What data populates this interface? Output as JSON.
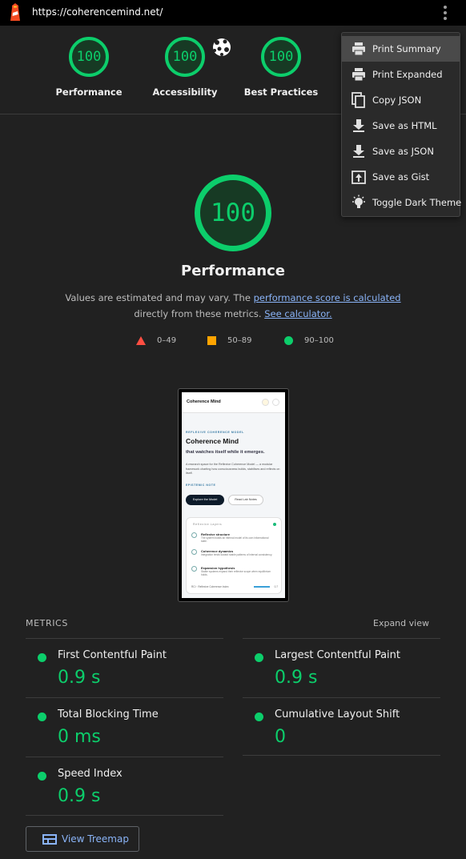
{
  "browser": {
    "url": "https://coherencemind.net/"
  },
  "summary_gauges": [
    {
      "label": "Performance",
      "score": "100"
    },
    {
      "label": "Accessibility",
      "score": "100"
    },
    {
      "label": "Best Practices",
      "score": "100"
    }
  ],
  "performance": {
    "score": "100",
    "title": "Performance",
    "desc_part1": "Values are estimated and may vary. The ",
    "desc_link1": "performance score is calculated",
    "desc_part2": "directly from these metrics. ",
    "desc_link2": "See calculator."
  },
  "legend": [
    {
      "label": "0–49",
      "color": "#ff4e42",
      "shape": "triangle"
    },
    {
      "label": "50–89",
      "color": "#ffa400",
      "shape": "square"
    },
    {
      "label": "90–100",
      "color": "#0cce6b",
      "shape": "circle"
    }
  ],
  "thumbnail": {
    "brand": "Coherence Mind",
    "eyebrow": "REFLEXIVE COHERENCE MODEL",
    "heading": "Coherence Mind",
    "subheading": "that watches itself while it emerges.",
    "paragraph": "A research space for the Reflexive Coherence Model — a modular framework charting how consciousness builds, stabilises and reflects on itself.",
    "note_label": "EPISTEMIC NOTE",
    "primary_button": "Explore the Model",
    "secondary_button": "Read Lab Notes",
    "card_title": "Reflexive Layers",
    "card_rows": [
      {
        "title": "Reflexive structure",
        "desc": "The system builds an internal model of its own informational state."
      },
      {
        "title": "Coherence dynamics",
        "desc": "Integration tends toward stable patterns of internal consistency."
      },
      {
        "title": "Expansion hypothesis",
        "desc": "Stable systems expand their reflexive scope when equilibrium holds."
      }
    ],
    "card_footer": "RCI · Reflexive Coherence Index",
    "card_footer_value": "0.7"
  },
  "metrics": {
    "header": "METRICS",
    "expand_label": "Expand view",
    "items": [
      {
        "name": "First Contentful Paint",
        "value": "0.9 s"
      },
      {
        "name": "Largest Contentful Paint",
        "value": "0.9 s"
      },
      {
        "name": "Total Blocking Time",
        "value": "0 ms"
      },
      {
        "name": "Cumulative Layout Shift",
        "value": "0"
      },
      {
        "name": "Speed Index",
        "value": "0.9 s"
      }
    ]
  },
  "treemap_button": "View Treemap",
  "menu": {
    "items": [
      {
        "label": "Print Summary",
        "icon": "printer-icon"
      },
      {
        "label": "Print Expanded",
        "icon": "printer-icon"
      },
      {
        "label": "Copy JSON",
        "icon": "copy-icon"
      },
      {
        "label": "Save as HTML",
        "icon": "download-icon"
      },
      {
        "label": "Save as JSON",
        "icon": "download-icon"
      },
      {
        "label": "Save as Gist",
        "icon": "upload-icon"
      },
      {
        "label": "Toggle Dark Theme",
        "icon": "lightbulb-icon"
      }
    ]
  },
  "colors": {
    "pass": "#0cce6b",
    "average": "#ffa400",
    "fail": "#ff4e42",
    "link": "#8ab4f8"
  }
}
